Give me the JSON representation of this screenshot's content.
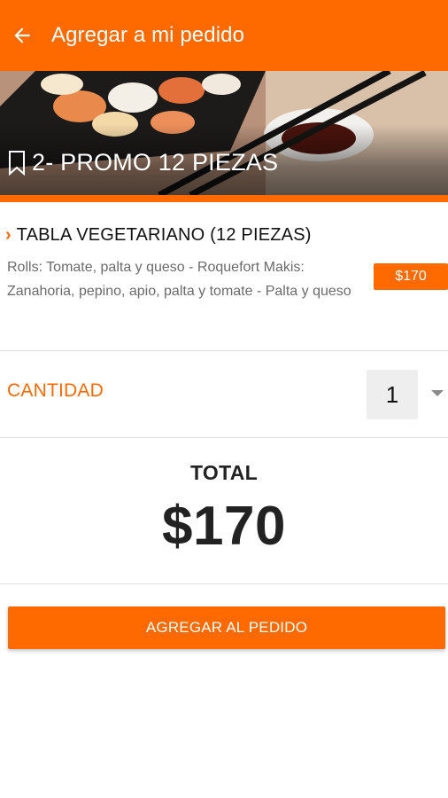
{
  "appbar": {
    "title": "Agregar a mi pedido",
    "back_icon": "arrow-left-icon"
  },
  "hero": {
    "title": "2- PROMO 12 PIEZAS",
    "bookmark_icon": "bookmark-icon"
  },
  "item": {
    "name": "TABLA VEGETARIANO (12 PIEZAS)",
    "description": "Rolls: Tomate, palta y queso - Roquefort Makis: Zanahoria, pepino, apio, palta y tomate - Palta y queso",
    "price": "$170"
  },
  "quantity": {
    "label": "CANTIDAD",
    "value": "1"
  },
  "total": {
    "label": "TOTAL",
    "amount": "$170"
  },
  "actions": {
    "add_label": "AGREGAR AL PEDIDO"
  },
  "colors": {
    "accent": "#ff6a00",
    "text": "#222222",
    "muted": "#6b6b6b"
  }
}
